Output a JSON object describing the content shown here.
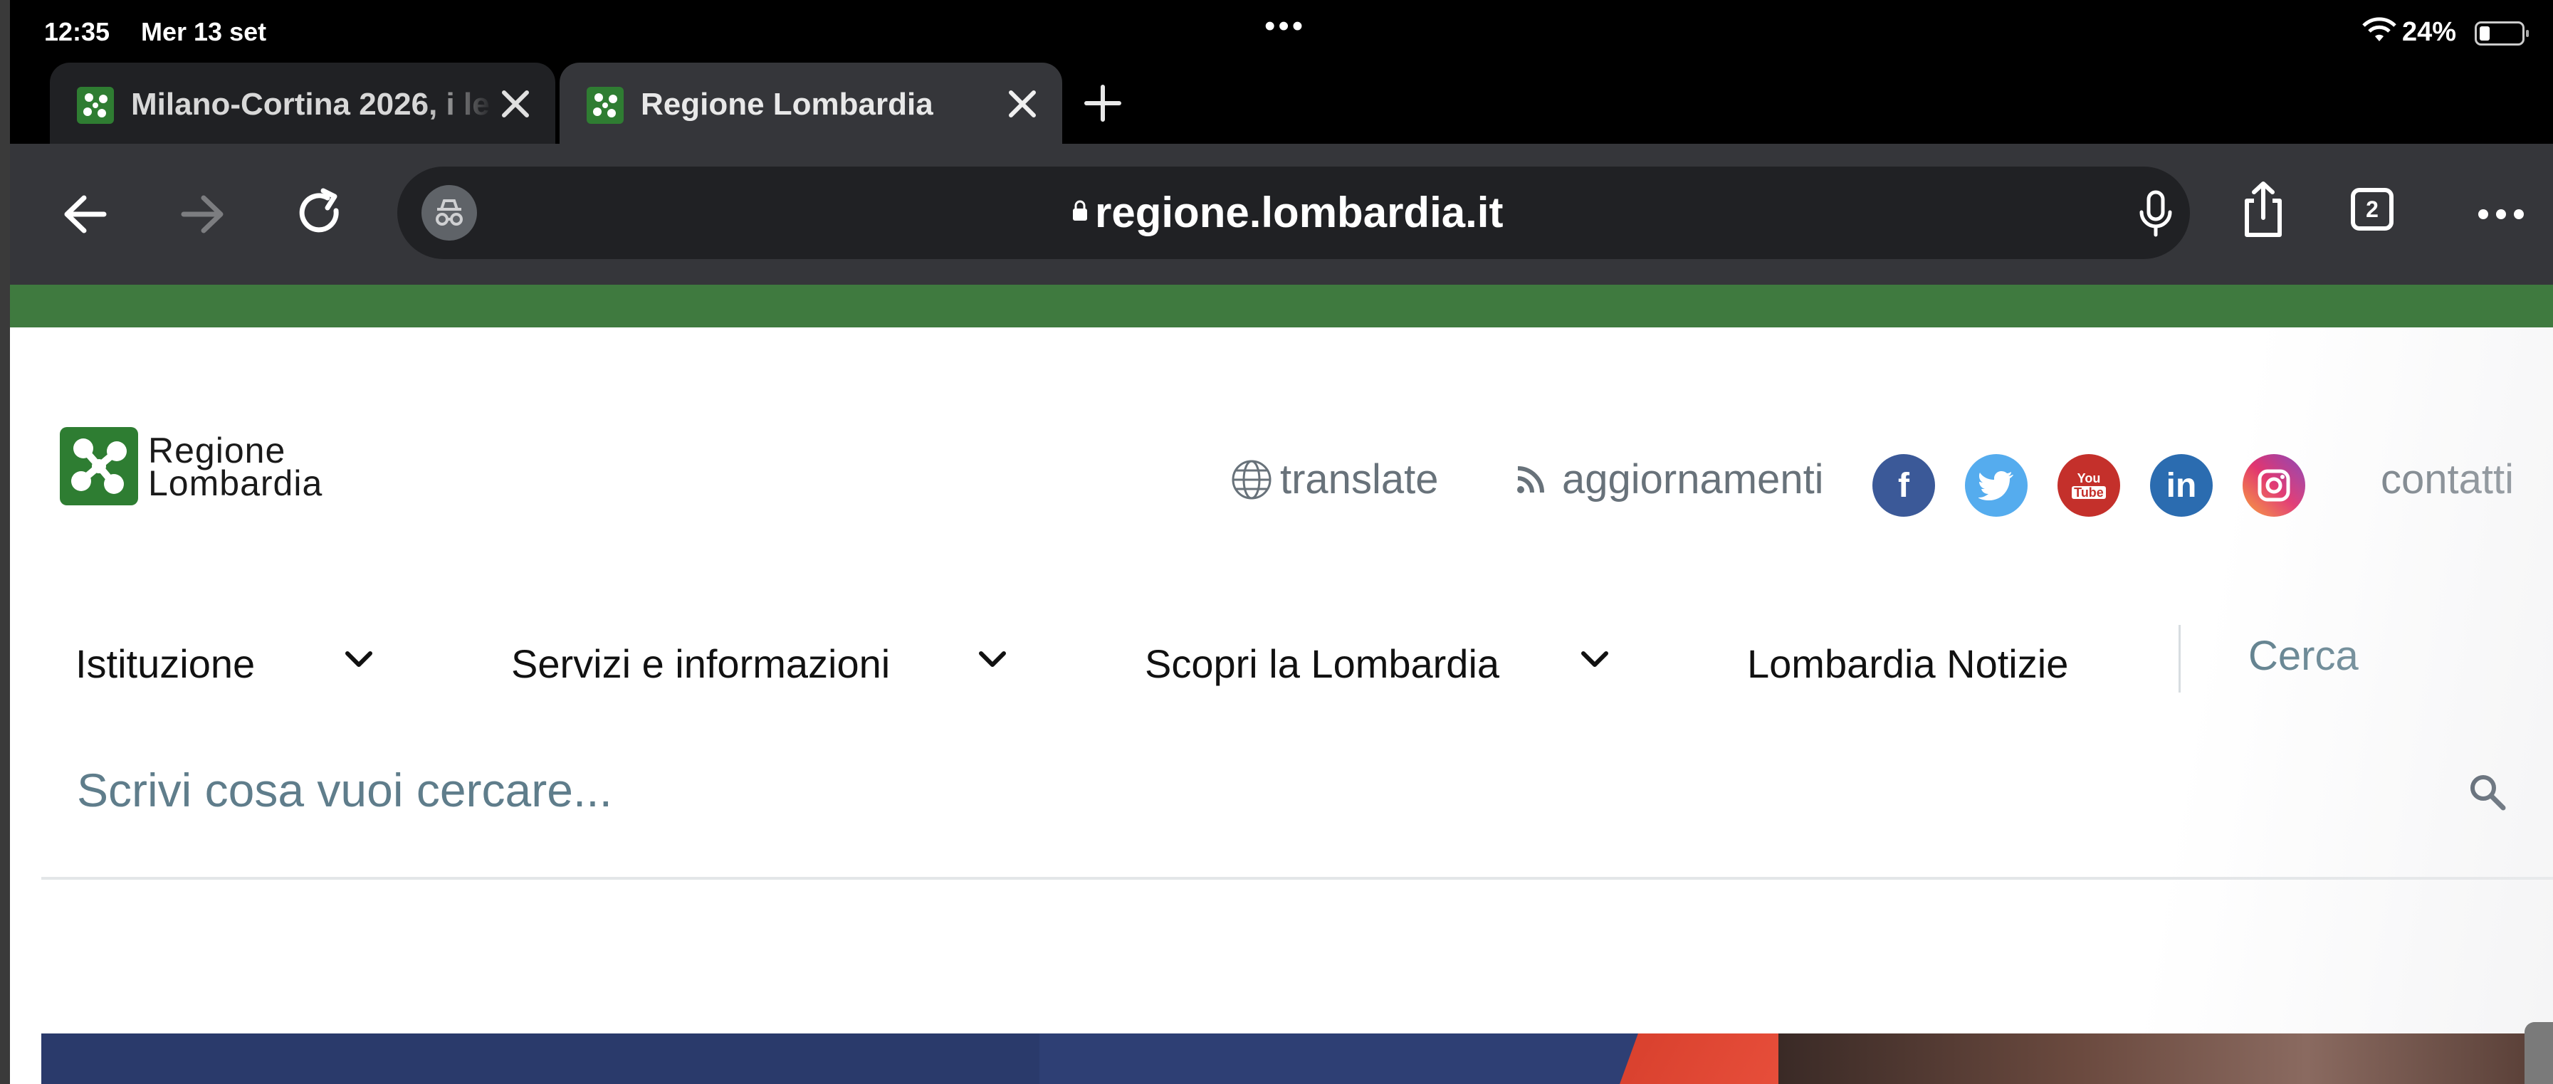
{
  "status_bar": {
    "time": "12:35",
    "date": "Mer 13 set",
    "battery": "24%"
  },
  "tabs": [
    {
      "title": "Milano-Cortina 2026, i le",
      "active": false
    },
    {
      "title": "Regione Lombardia",
      "active": true
    }
  ],
  "toolbar": {
    "url": "regione.lombardia.it",
    "tab_count": "2"
  },
  "site": {
    "logo_line1": "Regione",
    "logo_line2": "Lombardia",
    "utility": {
      "translate": "translate",
      "updates": "aggiornamenti",
      "contacts": "contatti"
    },
    "social": [
      {
        "name": "facebook",
        "color": "#3b5998",
        "glyph": "f"
      },
      {
        "name": "twitter",
        "color": "#55acee",
        "glyph": "bird"
      },
      {
        "name": "youtube",
        "color": "#c4302b",
        "glyph": "You Tube"
      },
      {
        "name": "linkedin",
        "color": "#2b6cb0",
        "glyph": "in"
      },
      {
        "name": "instagram",
        "color": "#c13584",
        "glyph": "camera"
      }
    ],
    "nav": {
      "items": [
        {
          "label": "Istituzione",
          "has_dropdown": true
        },
        {
          "label": "Servizi e informazioni",
          "has_dropdown": true
        },
        {
          "label": "Scopri la Lombardia",
          "has_dropdown": true
        },
        {
          "label": "Lombardia Notizie",
          "has_dropdown": false
        }
      ],
      "search_label": "Cerca"
    },
    "search": {
      "placeholder": "Scrivi cosa vuoi cercare..."
    },
    "colors": {
      "brand_green": "#3f7a3f",
      "link_grey": "#68727a",
      "hero_navy": "#2a3a6b",
      "hero_red": "#e04a36"
    }
  }
}
